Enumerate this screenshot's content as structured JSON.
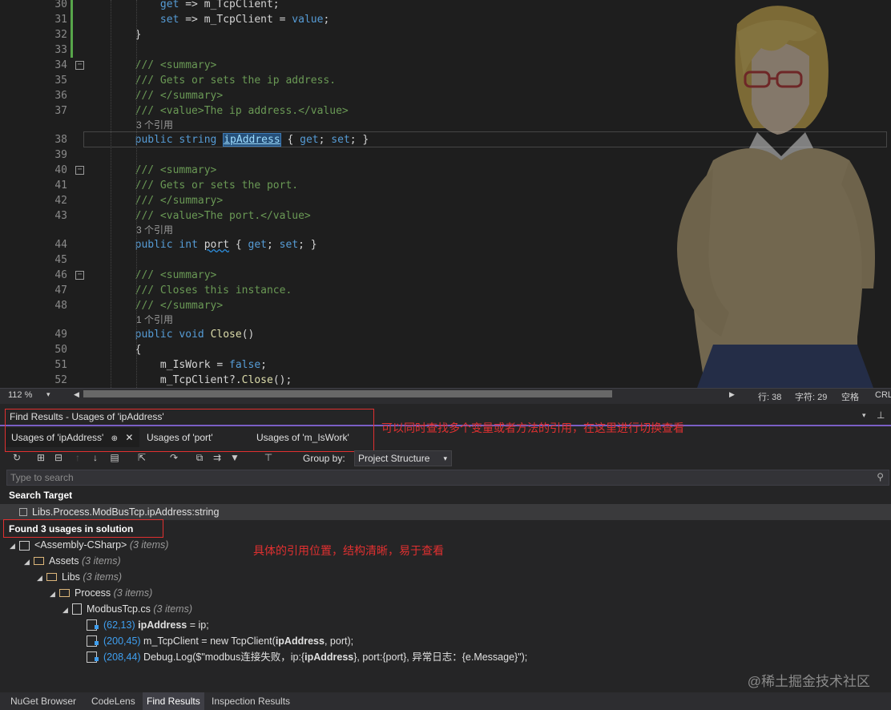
{
  "editor": {
    "lines": [
      {
        "n": "30",
        "parts": [
          [
            "",
            "            "
          ],
          [
            "kw",
            "get"
          ],
          [
            "",
            " => m_TcpClient;"
          ]
        ]
      },
      {
        "n": "31",
        "parts": [
          [
            "",
            "            "
          ],
          [
            "kw",
            "set"
          ],
          [
            "",
            " => m_TcpClient = "
          ],
          [
            "kw",
            "value"
          ],
          [
            "",
            ";"
          ]
        ]
      },
      {
        "n": "32",
        "parts": [
          [
            "",
            "        }"
          ]
        ]
      },
      {
        "n": "33",
        "parts": [
          [
            "",
            ""
          ]
        ]
      },
      {
        "n": "34",
        "parts": [
          [
            "cm",
            "        /// <summary>"
          ]
        ]
      },
      {
        "n": "35",
        "parts": [
          [
            "cm",
            "        /// Gets or sets the ip address."
          ]
        ]
      },
      {
        "n": "36",
        "parts": [
          [
            "cm",
            "        /// </summary>"
          ]
        ]
      },
      {
        "n": "37",
        "parts": [
          [
            "cm",
            "        /// <value>The ip address.</value>"
          ]
        ]
      },
      {
        "n": "38",
        "parts": [
          [
            "",
            "        "
          ],
          [
            "kw",
            "public"
          ],
          [
            "",
            " "
          ],
          [
            "kw",
            "string"
          ],
          [
            "",
            " "
          ],
          [
            "hl",
            "ipAddress"
          ],
          [
            "",
            " { "
          ],
          [
            "kw",
            "get"
          ],
          [
            "",
            "; "
          ],
          [
            "kw",
            "set"
          ],
          [
            "",
            "; }"
          ]
        ]
      },
      {
        "n": "39",
        "parts": [
          [
            "",
            ""
          ]
        ]
      },
      {
        "n": "40",
        "parts": [
          [
            "cm",
            "        /// <summary>"
          ]
        ]
      },
      {
        "n": "41",
        "parts": [
          [
            "cm",
            "        /// Gets or sets the port."
          ]
        ]
      },
      {
        "n": "42",
        "parts": [
          [
            "cm",
            "        /// </summary>"
          ]
        ]
      },
      {
        "n": "43",
        "parts": [
          [
            "cm",
            "        /// <value>The port.</value>"
          ]
        ]
      },
      {
        "n": "44",
        "parts": [
          [
            "",
            "        "
          ],
          [
            "kw",
            "public"
          ],
          [
            "",
            " "
          ],
          [
            "kw",
            "int"
          ],
          [
            "",
            " "
          ],
          [
            "sq",
            "port"
          ],
          [
            "",
            " { "
          ],
          [
            "kw",
            "get"
          ],
          [
            "",
            "; "
          ],
          [
            "kw",
            "set"
          ],
          [
            "",
            "; }"
          ]
        ]
      },
      {
        "n": "45",
        "parts": [
          [
            "",
            ""
          ]
        ]
      },
      {
        "n": "46",
        "parts": [
          [
            "cm",
            "        /// <summary>"
          ]
        ]
      },
      {
        "n": "47",
        "parts": [
          [
            "cm",
            "        /// Closes this instance."
          ]
        ]
      },
      {
        "n": "48",
        "parts": [
          [
            "cm",
            "        /// </summary>"
          ]
        ]
      },
      {
        "n": "49",
        "parts": [
          [
            "",
            "        "
          ],
          [
            "kw",
            "public"
          ],
          [
            "",
            " "
          ],
          [
            "kw",
            "void"
          ],
          [
            "",
            " "
          ],
          [
            "fn",
            "Close"
          ],
          [
            "",
            "()"
          ]
        ]
      },
      {
        "n": "50",
        "parts": [
          [
            "",
            "        {"
          ]
        ]
      },
      {
        "n": "51",
        "parts": [
          [
            "",
            "            m_IsWork = "
          ],
          [
            "kw",
            "false"
          ],
          [
            "",
            ";"
          ]
        ]
      },
      {
        "n": "52",
        "parts": [
          [
            "",
            "            m_TcpClient?."
          ],
          [
            "fn",
            "Close"
          ],
          [
            "",
            "();"
          ]
        ]
      }
    ],
    "lenses": [
      {
        "after": "37",
        "text": "3 个引用"
      },
      {
        "after": "43",
        "text": "3 个引用"
      },
      {
        "after": "48",
        "text": "1 个引用"
      }
    ]
  },
  "status": {
    "zoom": "112 %",
    "line": "行: 38",
    "col": "字符: 29",
    "mode": "空格",
    "eol": "CRL"
  },
  "panel": {
    "title": "Find Results - Usages of 'ipAddress'",
    "tabs": [
      "Usages of 'ipAddress'",
      "Usages of 'port'",
      "Usages of 'm_IsWork'"
    ],
    "pin": "⊕",
    "close": "✕",
    "group_by_label": "Group by:",
    "group_by_value": "Project Structure",
    "search_placeholder": "Type to search",
    "search_target_header": "Search Target",
    "search_target": "Libs.Process.ModBusTcp.ipAddress:string",
    "found_header": "Found 3 usages in solution",
    "annotation_tabs": "可以同时查找多个变量或者方法的引用，在这里进行切换查看",
    "annotation_tree": "具体的引用位置，结构清晰，易于查看"
  },
  "tree": {
    "assembly": {
      "label": "<Assembly-CSharp>",
      "count": "(3 items)"
    },
    "assets": {
      "label": "Assets",
      "count": "(3 items)"
    },
    "libs": {
      "label": "Libs",
      "count": "(3 items)"
    },
    "process": {
      "label": "Process",
      "count": "(3 items)"
    },
    "file": {
      "label": "ModbusTcp.cs",
      "count": "(3 items)"
    },
    "usages": [
      {
        "pos": "(62,13)",
        "pre": "",
        "bold": "ipAddress",
        "post": " = ip;"
      },
      {
        "pos": "(200,45)",
        "pre": "m_TcpClient = new TcpClient(",
        "bold": "ipAddress",
        "post": ", port);"
      },
      {
        "pos": "(208,44)",
        "pre": "Debug.Log($\"modbus连接失败，ip:{",
        "bold": "ipAddress",
        "post": "}, port:{port}, 异常日志：{e.Message}\");"
      }
    ]
  },
  "bottom_tabs": [
    "NuGet Browser",
    "CodeLens",
    "Find Results",
    "Inspection Results"
  ],
  "active_bottom_tab": "Find Results",
  "watermark": "@稀土掘金技术社区"
}
